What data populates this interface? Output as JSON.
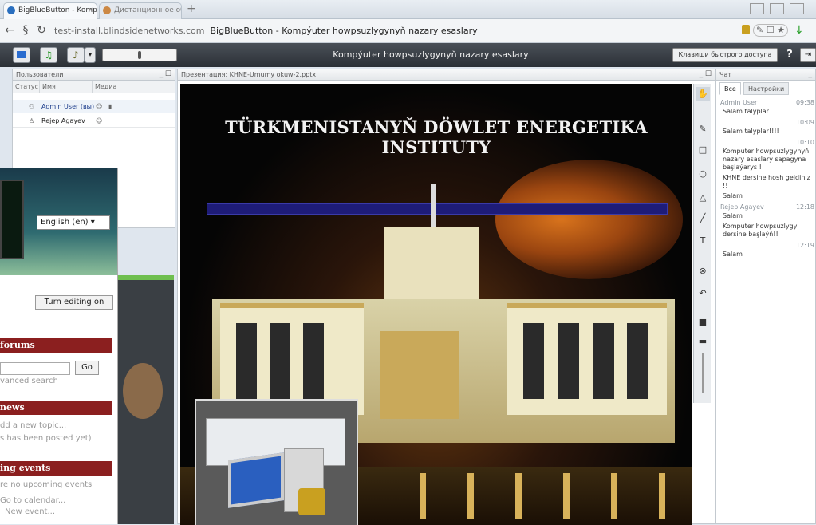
{
  "browser": {
    "tabs": [
      {
        "label": "BigBlueButton - Komp",
        "active": true
      },
      {
        "label": "Дистанционное обу",
        "active": false
      }
    ],
    "url_host": "test-install.blindsidenetworks.com",
    "url_title": "BigBlueButton - Kompýuter howpsuzlygynyň nazary esaslary"
  },
  "bbb": {
    "meeting_title": "Kompýuter howpsuzlygynyň nazary esaslary",
    "hotkeys_label": "Клавиши быстрого доступа",
    "help_label": "?"
  },
  "users": {
    "title": "Пользователи",
    "columns": [
      "Статус",
      "Имя",
      "Медиа"
    ],
    "rows": [
      {
        "name": "Admin User (вы)"
      },
      {
        "name": "Rejep Agayev"
      }
    ]
  },
  "presentation": {
    "title": "Презентация: KHNE-Umumy okuw-2.pptx",
    "slide_title": "TÜRKMENISTANYŇ DÖWLET ENERGETIKA INSTITUTY"
  },
  "chat": {
    "title": "Чат",
    "tabs": [
      "Все",
      "Настройки"
    ],
    "messages": [
      {
        "author": "Admin User",
        "time": "09:38",
        "text": "Salam talyplar"
      },
      {
        "author": "",
        "time": "10:09",
        "text": "Salam talyplar!!!!"
      },
      {
        "author": "",
        "time": "10:10",
        "text": "Komputer howpsuzlygynyň nazary esaslary sapagyna başlaýarys !!"
      },
      {
        "author": "",
        "time": "",
        "text": "KHNE dersine hosh geldiniz !!"
      },
      {
        "author": "",
        "time": "",
        "text": "Salam"
      },
      {
        "author": "Rejep Agayev",
        "time": "12:18",
        "text": "Salam"
      },
      {
        "author": "",
        "time": "",
        "text": "Komputer howpsuzlygy dersine başlaýň!!"
      },
      {
        "author": "",
        "time": "12:19",
        "text": "Salam"
      }
    ]
  },
  "moodle": {
    "language": "English (en)",
    "editing_button": "Turn editing on",
    "forums_title": "forums",
    "go_label": "Go",
    "advanced_search": "vanced search",
    "news_title": "news",
    "add_topic": "dd a new topic...",
    "no_news": "s has been posted yet)",
    "events_title": "ing events",
    "no_events": "re no upcoming events",
    "calendar": "Go to calendar...",
    "new_event": "New event..."
  }
}
